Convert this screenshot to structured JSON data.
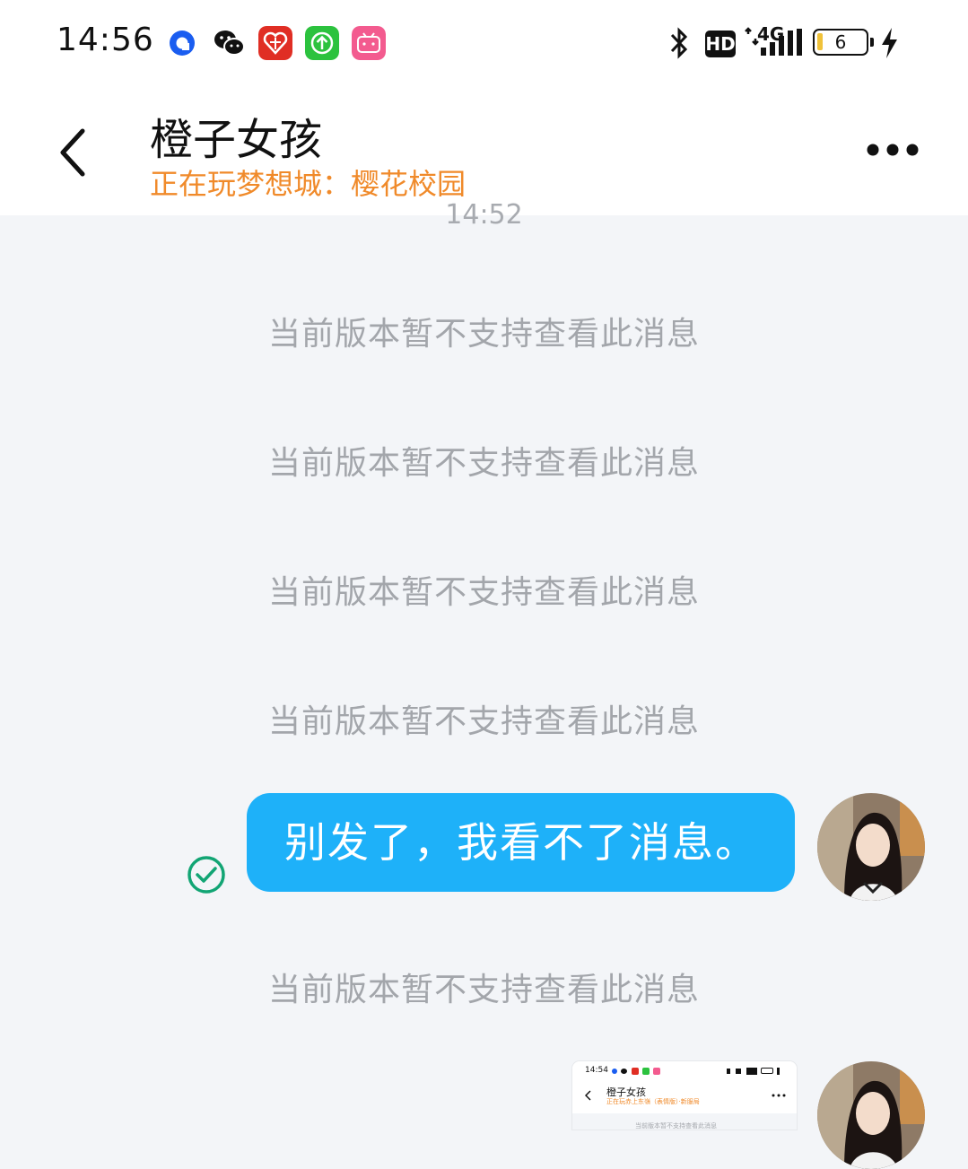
{
  "status_bar": {
    "time": "14:56",
    "network": "4G",
    "hd_label": "HD",
    "battery_level": "6",
    "icons": [
      "app-blue-icon",
      "wechat-icon",
      "pinduoduo-icon",
      "upload-app-icon",
      "bilibili-icon",
      "bluetooth-icon",
      "hd-icon",
      "signal-icon",
      "battery-icon",
      "charging-icon"
    ]
  },
  "header": {
    "title": "橙子女孩",
    "subtitle": "正在玩梦想城：樱花校园"
  },
  "chat": {
    "timestamp": "14:52",
    "unsupported_message": "当前版本暂不支持查看此消息",
    "sent_text": "别发了，我看不了消息。"
  },
  "thumbnail": {
    "time": "14:54",
    "title": "橙子女孩",
    "subtitle": "正在玩赤上东嶺（表情版）·新服局",
    "message": "当前版本暂不支持查看此消息"
  },
  "colors": {
    "bubble": "#1eb1f9",
    "subtitle": "#f08a2a",
    "background": "#f3f5f8",
    "check": "#12a574"
  }
}
